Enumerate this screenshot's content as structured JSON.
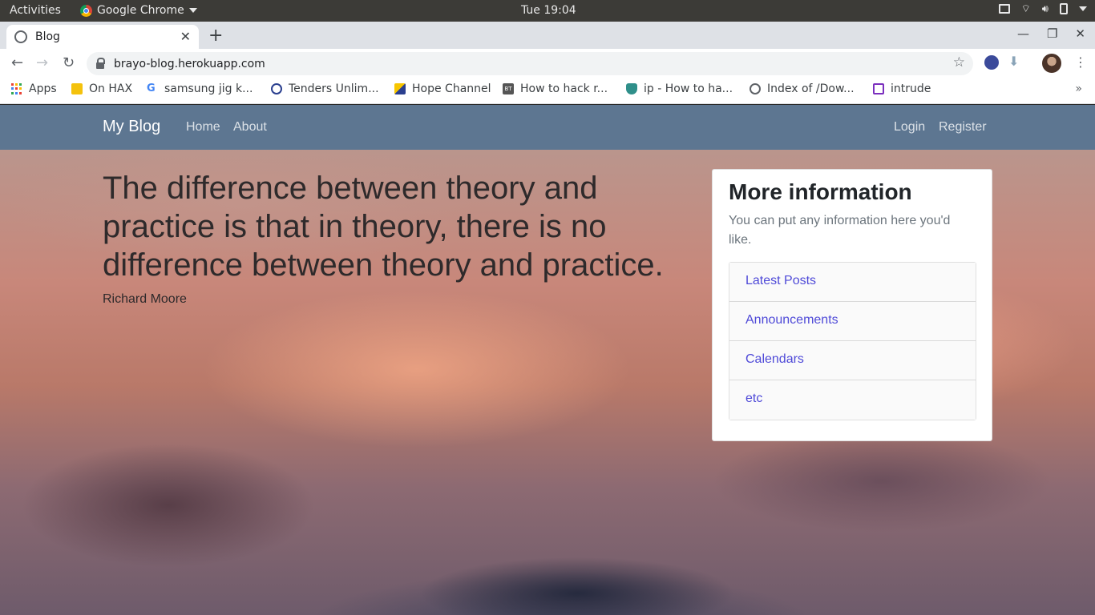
{
  "system_bar": {
    "activities": "Activities",
    "app_name": "Google Chrome",
    "clock": "Tue 19:04"
  },
  "browser": {
    "tab_title": "Blog",
    "url": "brayo-blog.herokuapp.com",
    "bookmarks": [
      {
        "label": "Apps"
      },
      {
        "label": "On HAX"
      },
      {
        "label": "samsung jig k..."
      },
      {
        "label": "Tenders Unlim..."
      },
      {
        "label": "Hope Channel"
      },
      {
        "label": "How to hack r..."
      },
      {
        "label": "ip - How to ha..."
      },
      {
        "label": "Index of /Dow..."
      },
      {
        "label": "intrude"
      }
    ],
    "more_bookmarks": "»"
  },
  "site": {
    "brand": "My Blog",
    "nav_left": [
      "Home",
      "About"
    ],
    "nav_right": [
      "Login",
      "Register"
    ],
    "quote": "The difference between theory and practice is that in theory, there is no difference between theory and practice.",
    "author": "Richard Moore",
    "sidebar": {
      "title": "More information",
      "text": "You can put any information here you'd like.",
      "links": [
        "Latest Posts",
        "Announcements",
        "Calendars",
        "etc"
      ]
    }
  },
  "colors": {
    "navbar": "#5d7691",
    "link": "#4f4ad8"
  }
}
